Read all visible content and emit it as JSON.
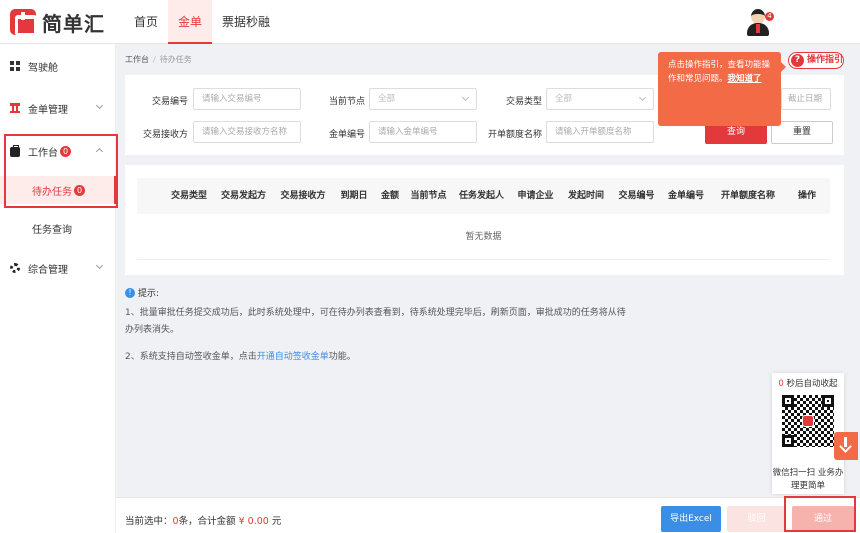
{
  "brand": {
    "name": "简单汇"
  },
  "topnav": [
    {
      "label": "首页",
      "active": false
    },
    {
      "label": "金单",
      "active": true
    },
    {
      "label": "票据秒融",
      "active": false
    }
  ],
  "user": {
    "notification_count": "4"
  },
  "sidebar": {
    "items": [
      {
        "label": "驾驶舱",
        "icon": "dashboard-icon"
      },
      {
        "label": "金单管理",
        "icon": "bank-icon"
      },
      {
        "label": "工作台",
        "icon": "briefcase-icon",
        "badge": "0",
        "expanded": true
      },
      {
        "label": "综合管理",
        "icon": "gear-icon"
      }
    ],
    "sub_items": [
      {
        "label": "待办任务",
        "badge": "0",
        "active": true
      },
      {
        "label": "任务查询",
        "active": false
      }
    ]
  },
  "breadcrumb": {
    "root": "工作台",
    "sep": "/",
    "current": "待办任务"
  },
  "guide": {
    "button_label": "操作指引",
    "popup_text": "点击操作指引，查看功能操作和常见问题。",
    "popup_link": "我知道了"
  },
  "filters": {
    "row1": [
      {
        "label": "交易编号",
        "placeholder": "请输入交易编号",
        "type": "input"
      },
      {
        "label": "当前节点",
        "value": "全部",
        "type": "select"
      },
      {
        "label": "交易类型",
        "value": "全部",
        "type": "select"
      },
      {
        "label": "",
        "placeholder": "截止日期",
        "type": "input"
      }
    ],
    "row2": [
      {
        "label": "交易接收方",
        "placeholder": "请输入交易接收方名称",
        "type": "input"
      },
      {
        "label": "金单编号",
        "placeholder": "请输入金单编号",
        "type": "input"
      },
      {
        "label": "开单额度名称",
        "placeholder": "请输入开单额度名称",
        "type": "input"
      }
    ],
    "query_label": "查询",
    "reset_label": "重置"
  },
  "table": {
    "columns": [
      "交易类型",
      "交易发起方",
      "交易接收方",
      "到期日",
      "金额",
      "当前节点",
      "任务发起人",
      "申请企业",
      "发起时间",
      "交易编号",
      "金单编号",
      "开单额度名称",
      "操作"
    ],
    "empty_text": "暂无数据"
  },
  "tips": {
    "title": "提示:",
    "line1": "1、批量审批任务提交成功后，此时系统处理中，可在待办列表查看到，待系统处理完毕后，刷新页面，审批成功的任务将从待办列表消失。",
    "line2_prefix": "2、系统支持自动签收金单，点击",
    "line2_link": "开通自动签收金单",
    "line2_suffix": "功能。"
  },
  "qr": {
    "countdown_num": "0",
    "countdown_text": "秒后自动收起",
    "caption": "微信扫一扫 业务办理更简单"
  },
  "footer": {
    "selected_prefix": "当前选中：",
    "selected_count": "0",
    "selected_mid": "条，合计金额",
    "amount": "¥ 0.00",
    "unit": "元",
    "export_label": "导出Excel",
    "reject_label": "驳回",
    "approve_label": "通过"
  },
  "colors": {
    "accent": "#e4393c",
    "link": "#3a8ee6",
    "popup": "#f26a46"
  }
}
